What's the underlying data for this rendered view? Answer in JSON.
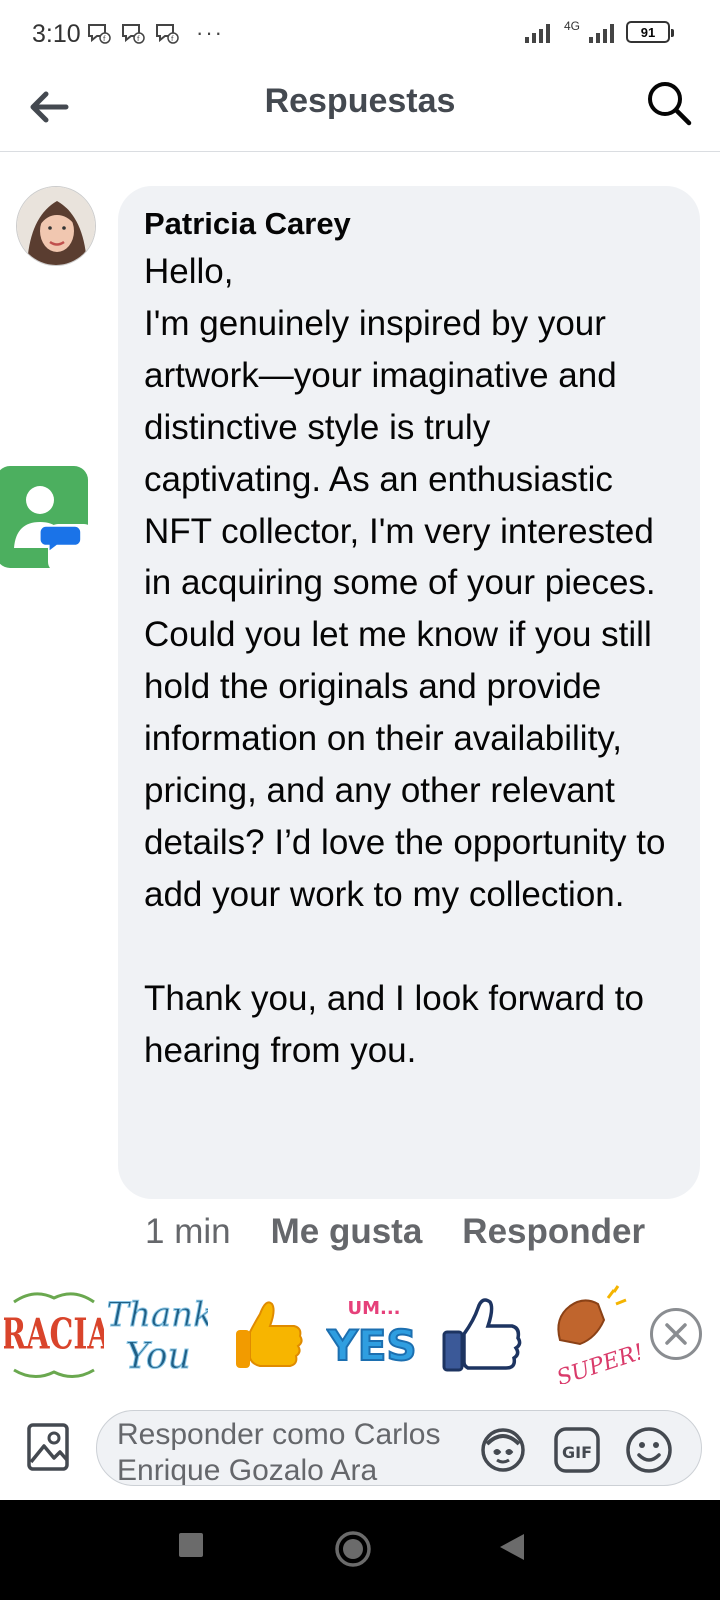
{
  "status_bar": {
    "time": "3:10",
    "more": "···",
    "network": "4G",
    "battery": "91"
  },
  "header": {
    "title": "Respuestas"
  },
  "comment": {
    "author": "Patricia Carey",
    "text": "Hello,\nI'm genuinely inspired by your artwork—your imaginative and distinctive style is truly captivating. As an enthusiastic NFT collector, I'm very interested in acquiring some of your pieces. Could you let me know if you still hold the originals and provide information on their availability, pricing, and any other relevant details? I’d love the opportunity to add your work to my collection.\n\nThank you, and I look forward to hearing from you.",
    "time": "1 min",
    "like_label": "Me gusta",
    "reply_label": "Responder"
  },
  "stickers": [
    {
      "name": "GRACIAS"
    },
    {
      "name": "Thank You"
    },
    {
      "name": "thumbs up"
    },
    {
      "name": "UM... YES"
    },
    {
      "name": "like"
    },
    {
      "name": "SUPER!"
    }
  ],
  "composer": {
    "placeholder": "Responder como Carlos Enrique Gozalo Ara",
    "gif_label": "GIF"
  },
  "colors": {
    "bubble": "#f0f2f5",
    "muted_text": "#65676b",
    "header_text": "#444950"
  }
}
